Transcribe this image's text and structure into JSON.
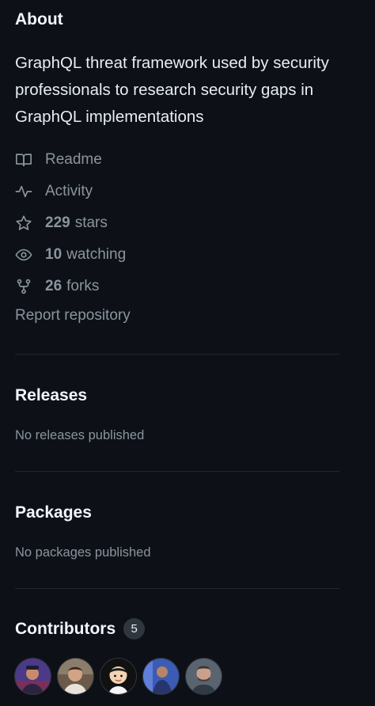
{
  "about": {
    "title": "About",
    "description": "GraphQL threat framework used by security professionals to research security gaps in GraphQL implementations",
    "items": [
      {
        "icon": "book-icon",
        "label": "Readme"
      },
      {
        "icon": "pulse-icon",
        "label": "Activity"
      },
      {
        "icon": "star-icon",
        "count": "229",
        "label": "stars"
      },
      {
        "icon": "eye-icon",
        "count": "10",
        "label": "watching"
      },
      {
        "icon": "fork-icon",
        "count": "26",
        "label": "forks"
      }
    ],
    "report": "Report repository"
  },
  "releases": {
    "title": "Releases",
    "empty": "No releases published"
  },
  "packages": {
    "title": "Packages",
    "empty": "No packages published"
  },
  "contributors": {
    "title": "Contributors",
    "count": "5",
    "avatars": [
      {
        "name": "contributor-avatar-1",
        "bg": "#4b3a8a"
      },
      {
        "name": "contributor-avatar-2",
        "bg": "#6b5a4a"
      },
      {
        "name": "contributor-avatar-3",
        "bg": "#111111"
      },
      {
        "name": "contributor-avatar-4",
        "bg": "#3b5bb5"
      },
      {
        "name": "contributor-avatar-5",
        "bg": "#5a6470"
      }
    ]
  },
  "colors": {
    "background": "#0d1117",
    "text": "#e6edf3",
    "muted": "#8b949e",
    "divider": "#21262d"
  }
}
